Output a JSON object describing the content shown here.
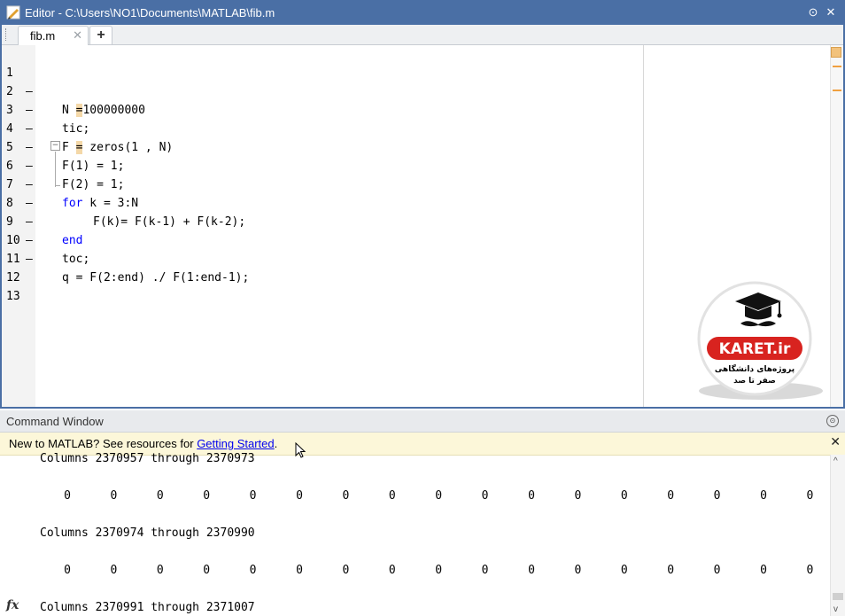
{
  "editor": {
    "title": "Editor - C:\\Users\\NO1\\Documents\\MATLAB\\fib.m",
    "tab_label": "fib.m",
    "tab_close": "✕",
    "tab_add": "+",
    "minimize": "⊙",
    "close": "✕",
    "lines": [
      {
        "num": "1",
        "dash": "–",
        "code": "N =100000000"
      },
      {
        "num": "2",
        "dash": "–",
        "code": "tic;"
      },
      {
        "num": "3",
        "dash": "–",
        "code": "F = zeros(1 , N)"
      },
      {
        "num": "4",
        "dash": "–",
        "code": "F(1) = 1;"
      },
      {
        "num": "5",
        "dash": "–",
        "code": "F(2) = 1;"
      },
      {
        "num": "6",
        "dash": "–",
        "code_kw": "for",
        "code_rest": " k = 3:N"
      },
      {
        "num": "7",
        "dash": "–",
        "code": "F(k)= F(k-1) + F(k-2);"
      },
      {
        "num": "8",
        "dash": "–",
        "code_kw": "end"
      },
      {
        "num": "9",
        "dash": "–",
        "code": "toc;"
      },
      {
        "num": "10",
        "dash": "–",
        "code": "q = F(2:end) ./ F(1:end-1);"
      },
      {
        "num": "11"
      },
      {
        "num": "12"
      },
      {
        "num": "13"
      }
    ],
    "fold_symbol": "−"
  },
  "logo": {
    "brand": "KARET.ir",
    "line1": "پروژه‌های دانشگاهی",
    "line2": "صفر تا صد"
  },
  "command_window": {
    "title": "Command Window",
    "title_btn": "⊙",
    "banner_prefix": "New to MATLAB? See resources for ",
    "banner_link": "Getting Started",
    "banner_suffix": ".",
    "banner_close": "✕",
    "block1_header": "Columns 2370957 through 2370973",
    "block2_header": "Columns 2370974 through 2370990",
    "block3_header": "Columns 2370991 through 2371007",
    "zero": "0",
    "fx": "fx",
    "scroll_up": "^",
    "scroll_down": "v"
  }
}
